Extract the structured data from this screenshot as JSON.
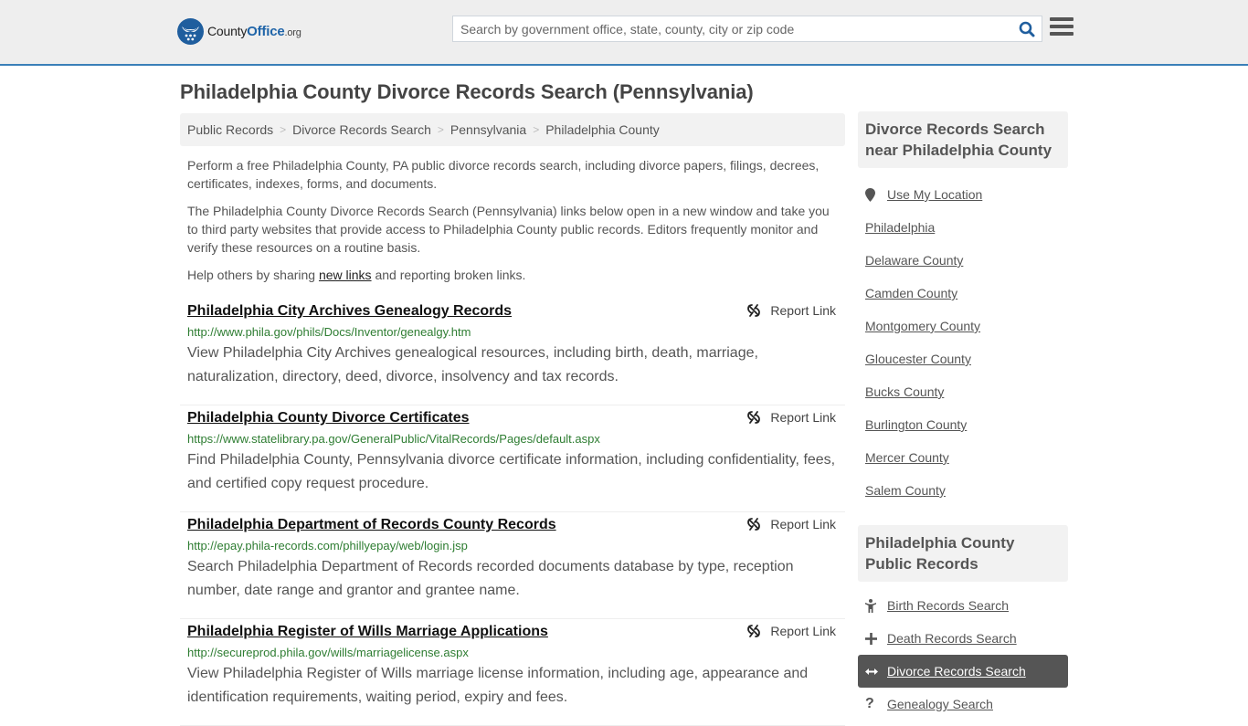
{
  "header": {
    "logo": {
      "name_prefix": "County",
      "name_brand": "Office",
      "name_suffix": ".org"
    },
    "search": {
      "placeholder": "Search by government office, state, county, city or zip code",
      "value": ""
    },
    "colors": {
      "brand_blue": "#1f64a8",
      "header_bg": "#eeeeee",
      "accent_line": "#3a7fb8"
    }
  },
  "page": {
    "title": "Philadelphia County Divorce Records Search (Pennsylvania)"
  },
  "breadcrumb": [
    {
      "label": "Public Records"
    },
    {
      "label": "Divorce Records Search"
    },
    {
      "label": "Pennsylvania"
    },
    {
      "label": "Philadelphia County"
    }
  ],
  "intro": {
    "p1": "Perform a free Philadelphia County, PA public divorce records search, including divorce papers, filings, decrees, certificates, indexes, forms, and documents.",
    "p2": "The Philadelphia County Divorce Records Search (Pennsylvania) links below open in a new window and take you to third party websites that provide access to Philadelphia County public records. Editors frequently monitor and verify these resources on a routine basis.",
    "p3_before": "Help others by sharing ",
    "p3_link": "new links",
    "p3_after": " and reporting broken links."
  },
  "results": [
    {
      "title": "Philadelphia City Archives Genealogy Records",
      "url": "http://www.phila.gov/phils/Docs/Inventor/genealgy.htm",
      "description": "View Philadelphia City Archives genealogical resources, including birth, death, marriage, naturalization, directory, deed, divorce, insolvency and tax records.",
      "report_label": "Report Link"
    },
    {
      "title": "Philadelphia County Divorce Certificates",
      "url": "https://www.statelibrary.pa.gov/GeneralPublic/VitalRecords/Pages/default.aspx",
      "description": "Find Philadelphia County, Pennsylvania divorce certificate information, including confidentiality, fees, and certified copy request procedure.",
      "report_label": "Report Link"
    },
    {
      "title": "Philadelphia Department of Records County Records",
      "url": "http://epay.phila-records.com/phillyepay/web/login.jsp",
      "description": "Search Philadelphia Department of Records recorded documents database by type, reception number, date range and grantor and grantee name.",
      "report_label": "Report Link"
    },
    {
      "title": "Philadelphia Register of Wills Marriage Applications",
      "url": "http://secureprod.phila.gov/wills/marriagelicense.aspx",
      "description": "View Philadelphia Register of Wills marriage license information, including age, appearance and identification requirements, waiting period, expiry and fees.",
      "report_label": "Report Link"
    }
  ],
  "sidebar": {
    "nearby_heading": "Divorce Records Search near Philadelphia County",
    "use_location": {
      "label": "Use My Location",
      "icon": "map-marker-icon"
    },
    "nearby": [
      {
        "label": "Philadelphia"
      },
      {
        "label": "Delaware County"
      },
      {
        "label": "Camden County"
      },
      {
        "label": "Montgomery County"
      },
      {
        "label": "Gloucester County"
      },
      {
        "label": "Bucks County"
      },
      {
        "label": "Burlington County"
      },
      {
        "label": "Mercer County"
      },
      {
        "label": "Salem County"
      }
    ],
    "records_heading": "Philadelphia County Public Records",
    "records": [
      {
        "label": "Birth Records Search",
        "icon": "child-icon",
        "active": false
      },
      {
        "label": "Death Records Search",
        "icon": "plus-icon",
        "active": false
      },
      {
        "label": "Divorce Records Search",
        "icon": "arrows-horizontal-icon",
        "active": true
      },
      {
        "label": "Genealogy Search",
        "icon": "question-icon",
        "active": false
      }
    ]
  }
}
